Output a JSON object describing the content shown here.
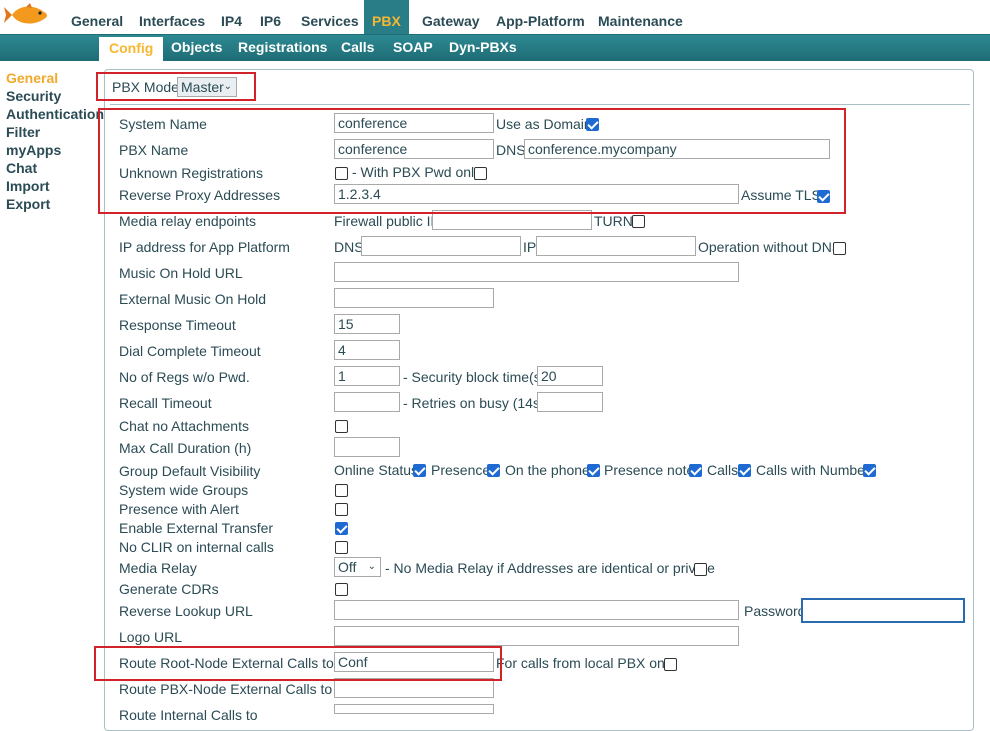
{
  "nav": {
    "main": [
      "General",
      "Interfaces",
      "IP4",
      "IP6",
      "Services",
      "PBX",
      "Gateway",
      "App-Platform",
      "Maintenance"
    ],
    "active_main": "PBX",
    "sub": [
      "Config",
      "Objects",
      "Registrations",
      "Calls",
      "SOAP",
      "Dyn-PBXs"
    ],
    "active_sub": "Config"
  },
  "sidebar": [
    "General",
    "Security",
    "Authentication",
    "Filter",
    "myApps",
    "Chat",
    "Import",
    "Export"
  ],
  "pbx_mode": {
    "label": "PBX Mode",
    "value": "Master"
  },
  "form": {
    "system_name": {
      "label": "System Name",
      "value": "conference",
      "use_as_domain": "Use as Domain"
    },
    "pbx_name": {
      "label": "PBX Name",
      "value": "conference",
      "dns_label": "DNS",
      "dns_value": "conference.mycompany"
    },
    "unknown_reg": {
      "label": "Unknown Registrations",
      "pwd_only": "- With PBX Pwd only"
    },
    "reverse_proxy": {
      "label": "Reverse Proxy Addresses",
      "value": "1.2.3.4",
      "assume_tls": "Assume TLS"
    },
    "media_relay_endpoints": {
      "label": "Media relay endpoints",
      "fw_label": "Firewall public IP",
      "turn": "TURN"
    },
    "app_platform_ip": {
      "label": "IP address for App Platform",
      "dns": "DNS",
      "ip": "IP",
      "no_dns": "Operation without DNS"
    },
    "moh_url": {
      "label": "Music On Hold URL"
    },
    "ext_moh": {
      "label": "External Music On Hold"
    },
    "response_timeout": {
      "label": "Response Timeout",
      "value": "15"
    },
    "dial_complete": {
      "label": "Dial Complete Timeout",
      "value": "4"
    },
    "regs_wo_pwd": {
      "label": "No of Regs w/o Pwd.",
      "value": "1",
      "sec_label": "- Security block time(s)",
      "sec_value": "20"
    },
    "recall_timeout": {
      "label": "Recall Timeout",
      "retries": "- Retries on busy (14s)"
    },
    "chat_no_attach": {
      "label": "Chat no Attachments"
    },
    "max_call_duration": {
      "label": "Max Call Duration (h)"
    },
    "group_visibility": {
      "label": "Group Default Visibility",
      "items": [
        "Online Status",
        "Presence",
        "On the phone",
        "Presence note",
        "Calls",
        "Calls with Number"
      ]
    },
    "system_wide_groups": {
      "label": "System wide Groups"
    },
    "presence_alert": {
      "label": "Presence with Alert"
    },
    "ext_transfer": {
      "label": "Enable External Transfer"
    },
    "no_clir": {
      "label": "No CLIR on internal calls"
    },
    "media_relay": {
      "label": "Media Relay",
      "value": "Off",
      "note": "- No Media Relay if Addresses are identical or private"
    },
    "cdrs": {
      "label": "Generate CDRs"
    },
    "reverse_lookup": {
      "label": "Reverse Lookup URL",
      "password": "Password"
    },
    "logo_url": {
      "label": "Logo URL"
    },
    "root_node": {
      "label": "Route Root-Node External Calls to",
      "value": "Conf",
      "local_only": "For calls from local PBX only"
    },
    "pbx_node": {
      "label": "Route PBX-Node External Calls to"
    },
    "internal_calls": {
      "label": "Route Internal Calls to"
    }
  },
  "colors": {
    "accent": "#f6b731",
    "teal": "#287d86",
    "highlight": "#d2232a",
    "check": "#1f6ad2"
  }
}
